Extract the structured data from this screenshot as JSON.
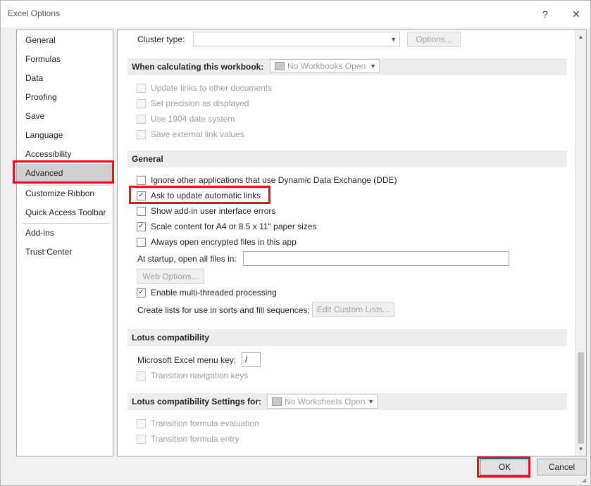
{
  "window": {
    "title": "Excel Options",
    "help_label": "?",
    "close_label": "✕"
  },
  "nav": {
    "items": [
      {
        "label": "General"
      },
      {
        "label": "Formulas"
      },
      {
        "label": "Data"
      },
      {
        "label": "Proofing"
      },
      {
        "label": "Save"
      },
      {
        "label": "Language"
      },
      {
        "label": "Accessibility"
      },
      {
        "label": "Advanced",
        "selected": true
      },
      {
        "label": "Customize Ribbon"
      },
      {
        "label": "Quick Access Toolbar"
      },
      {
        "label": "Add-ins"
      },
      {
        "label": "Trust Center"
      }
    ]
  },
  "content": {
    "cluster": {
      "label": "Cluster type:",
      "value": "",
      "options_button": "Options..."
    },
    "workbook_section": {
      "title": "When calculating this workbook:",
      "combo_value": "No Workbooks Open",
      "options": [
        {
          "label": "Update links to other documents",
          "checked": false
        },
        {
          "label": "Set precision as displayed",
          "checked": false
        },
        {
          "label": "Use 1904 date system",
          "checked": false
        },
        {
          "label": "Save external link values",
          "checked": false
        }
      ]
    },
    "general_section": {
      "title": "General",
      "options": [
        {
          "label": "Ignore other applications that use Dynamic Data Exchange (DDE)",
          "checked": false
        },
        {
          "label": "Ask to update automatic links",
          "checked": true
        },
        {
          "label": "Show add-in user interface errors",
          "checked": false
        },
        {
          "label": "Scale content for A4 or 8.5 x 11\" paper sizes",
          "checked": true
        },
        {
          "label": "Always open encrypted files in this app",
          "checked": false
        }
      ],
      "startup_label": "At startup, open all files in:",
      "startup_value": "",
      "web_options_button": "Web Options...",
      "multithread": {
        "label": "Enable multi-threaded processing",
        "checked": true
      },
      "lists_label": "Create lists for use in sorts and fill sequences:",
      "edit_lists_button": "Edit Custom Lists..."
    },
    "lotus_section": {
      "title": "Lotus compatibility",
      "menu_key_label": "Microsoft Excel menu key:",
      "menu_key_value": "/",
      "nav_keys": {
        "label": "Transition navigation keys",
        "checked": false
      }
    },
    "lotus_settings_section": {
      "title": "Lotus compatibility Settings for:",
      "combo_value": "No Worksheets Open",
      "options": [
        {
          "label": "Transition formula evaluation",
          "checked": false
        },
        {
          "label": "Transition formula entry",
          "checked": false
        }
      ]
    }
  },
  "footer": {
    "ok_label": "OK",
    "cancel_label": "Cancel"
  },
  "icons": {
    "checkmark": "✓",
    "dropdown": "▼",
    "scroll_up": "▲",
    "scroll_down": "▼"
  },
  "colors": {
    "highlight": "#e2141b",
    "selected_nav": "#cfcfcf",
    "section_bg": "#ededed"
  }
}
